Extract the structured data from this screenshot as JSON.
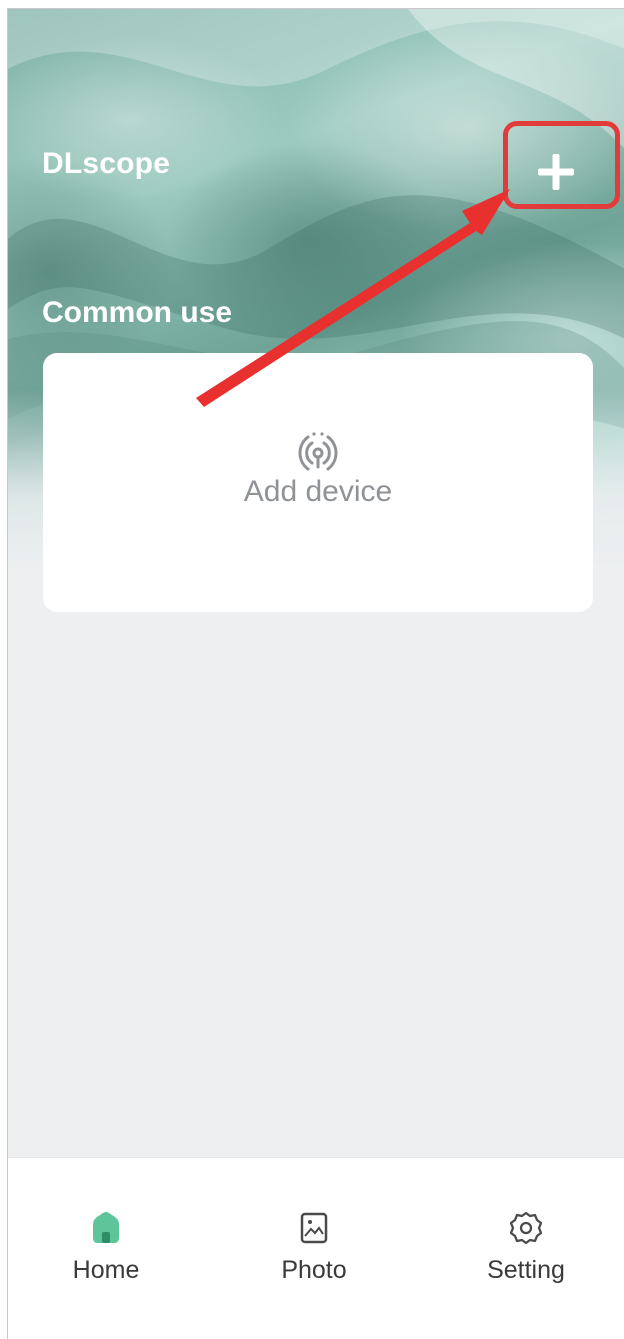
{
  "header": {
    "app_title": "DLscope",
    "add_icon": "plus-icon"
  },
  "section": {
    "title": "Common use"
  },
  "card": {
    "add_device_label": "Add device",
    "add_device_icon": "wireless-device-icon"
  },
  "tabs": [
    {
      "label": "Home",
      "icon": "home-icon",
      "active": true
    },
    {
      "label": "Photo",
      "icon": "photo-icon",
      "active": false
    },
    {
      "label": "Setting",
      "icon": "gear-icon",
      "active": false
    }
  ],
  "colors": {
    "accent": "#5ec49a",
    "annotation": "#e23b3b",
    "background": "#edeff1",
    "muted_text": "#8f9296"
  }
}
